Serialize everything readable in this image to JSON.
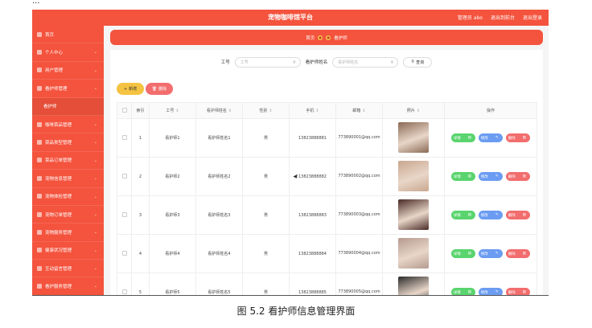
{
  "doc_top_text": "...",
  "app": {
    "title": "宠物咖啡馆平台",
    "header_links": [
      "管理员 abo",
      "退出到前台",
      "退出登录"
    ]
  },
  "sidebar": {
    "items": [
      {
        "label": "首页",
        "sub": false,
        "arrow": false
      },
      {
        "label": "个人中心",
        "sub": false,
        "arrow": true
      },
      {
        "label": "用户管理",
        "sub": false,
        "arrow": true
      },
      {
        "label": "看护师管理",
        "sub": false,
        "arrow": true
      },
      {
        "label": "看护师",
        "sub": true,
        "arrow": false
      },
      {
        "label": "咖啡菜品管理",
        "sub": false,
        "arrow": true
      },
      {
        "label": "菜品类型管理",
        "sub": false,
        "arrow": true
      },
      {
        "label": "菜品订单管理",
        "sub": false,
        "arrow": true
      },
      {
        "label": "宠物信息管理",
        "sub": false,
        "arrow": true
      },
      {
        "label": "宠物体检管理",
        "sub": false,
        "arrow": true
      },
      {
        "label": "宠物订单管理",
        "sub": false,
        "arrow": true
      },
      {
        "label": "宠物服务管理",
        "sub": false,
        "arrow": true
      },
      {
        "label": "健康状况管理",
        "sub": false,
        "arrow": true
      },
      {
        "label": "互动留言管理",
        "sub": false,
        "arrow": true
      },
      {
        "label": "看护服务管理",
        "sub": false,
        "arrow": true
      }
    ]
  },
  "breadcrumb": {
    "home": "首页",
    "current": "看护师"
  },
  "search": {
    "field1_label": "工号",
    "field1_placeholder": "工号",
    "field2_label": "看护师姓名",
    "field2_placeholder": "看护师姓名",
    "button_label": "查询"
  },
  "actions": {
    "add_label": "新增",
    "delete_label": "删除"
  },
  "table": {
    "headers": [
      "",
      "索引",
      "工号",
      "看护师姓名",
      "性别",
      "手机",
      "邮箱",
      "照片",
      "操作"
    ],
    "rows": [
      {
        "index": "1",
        "job_no": "看护师1",
        "name": "看护师姓名1",
        "gender": "男",
        "phone": "13823888881",
        "email": "773890001@qq.com",
        "photo_color": "#8a6a55"
      },
      {
        "index": "2",
        "job_no": "看护师2",
        "name": "看护师姓名2",
        "gender": "男",
        "phone": "13823888882",
        "email": "773890002@qq.com",
        "photo_color": "#c9a78f"
      },
      {
        "index": "3",
        "job_no": "看护师3",
        "name": "看护师姓名3",
        "gender": "男",
        "phone": "13823888883",
        "email": "773890003@qq.com",
        "photo_color": "#4a2a26"
      },
      {
        "index": "4",
        "job_no": "看护师4",
        "name": "看护师姓名4",
        "gender": "男",
        "phone": "13823888884",
        "email": "773890004@qq.com",
        "photo_color": "#b59a90"
      },
      {
        "index": "5",
        "job_no": "看护师5",
        "name": "看护师姓名5",
        "gender": "男",
        "phone": "13823888885",
        "email": "773890005@qq.com",
        "photo_color": "#2b2b2b"
      }
    ],
    "op_labels": {
      "detail": "详情",
      "edit": "修改",
      "remove": "删除"
    }
  },
  "caption": "图 5.2  看护师信息管理界面",
  "colors": {
    "primary": "#f4533d",
    "add": "#f5c342",
    "delete": "#f26d6d",
    "detail": "#5ad46e",
    "edit": "#6b9cf2"
  }
}
